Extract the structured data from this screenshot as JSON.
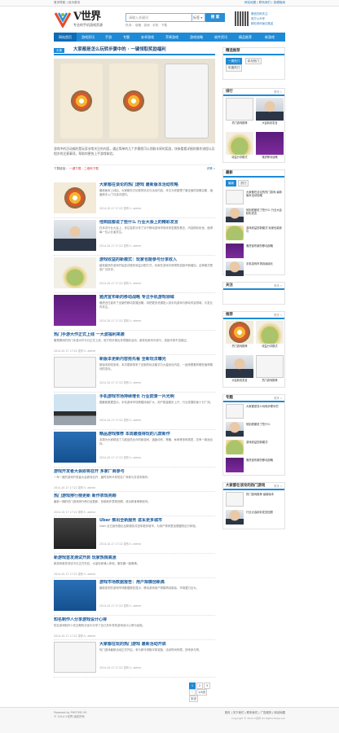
{
  "topbar": {
    "left": "首页导航 | 设为首页",
    "right": "网站地图 | 联系我们 | 投稿指南"
  },
  "logo": {
    "title": "V世界",
    "subtitle": "专业的手机游戏资源"
  },
  "search": {
    "placeholder": "请输入关键词",
    "select": "标签 ▾",
    "button": "搜 索",
    "hot": "热词： 攻略 · 游戏 · 手机 · 下载"
  },
  "header_right": {
    "line1": "微信扫码关注",
    "line2": "官方公众号",
    "line3": "精彩资讯每日推送"
  },
  "nav": [
    "网站首页",
    "游戏资讯",
    "手游",
    "专题",
    "安卓游戏",
    "苹果游戏",
    "游戏攻略",
    "软件资讯",
    "精品推荐",
    "新游戏"
  ],
  "featured": {
    "tag": "头条",
    "title": "大家都是怎么玩转步骤中的 · 一键领取奖励福利",
    "desc": "游戏中的活动福利是玩家非常关注的内容，通过简单的几个步骤就可以领取丰厚的奖励，快来看看详细的操作流程以及相关的注意事项，帮助你更快上手游戏体验。",
    "meta_label": "下载链接：",
    "meta_links": "一键下载 · 二维码下载",
    "more": "详情 »"
  },
  "posts": [
    {
      "title": "大家都在谈论的热门游戏 最新版本活动攻略",
      "desc": "最新版本上线后，大家都在讨论新的玩法与活动内容，本文为你整理了最全面的攻略合集，涵盖新手入门与高手进阶。",
      "meta": "2014-10-17 17:22 发布人: admin",
      "thumb": "t-wheel"
    },
    {
      "title": "他到底都说了些什么 行业大会上的精彩发言",
      "desc": "在本次行业大会上，多位嘉宾分享了对于移动游戏市场未来发展的看法，内容精彩纷呈，值得每一位从业者关注。",
      "meta": "2014-10-17 17:22 发布人: admin",
      "thumb": "t-person"
    },
    {
      "title": "游戏收益的新模式：玩家也能参与分享收入",
      "desc": "越来越多的游戏开始尝试新的收益分配方式，玩家在游戏中获得的奖励不断增加，这种模式受到广泛好评。",
      "meta": "2014-10-17 17:22 发布人: admin",
      "thumb": "t-money"
    },
    {
      "title": "雅虎宣布新的移动战略 专注手机游戏领域",
      "desc": "雅虎近日宣布了全新的移动发展战略，将把更多资源投入到手机游戏与移动内容领域，引发业内关注。",
      "meta": "2014-10-17 17:22 发布人: admin",
      "thumb": "t-yahoo"
    },
    {
      "title": "热门手游大作正式上线 一大波福利来袭",
      "desc": "备受期待的热门手游大作今日正式上线，官方同步推出多项福利活动，新老玩家均可参与，奖励丰厚不容错过。",
      "meta": "2014-10-17 17:22 发布人: admin",
      "text": true
    },
    {
      "title": "新版本更新内容抢先看 全新玩法曝光",
      "desc": "新版本即将到来，本次更新带来了全新的玩法模式与大量优化内容，一起来看看有哪些值得期待的变化。",
      "meta": "2014-10-17 17:22 发布人: admin",
      "thumb": "t-app"
    },
    {
      "title": "手机游戏市场持续增长 行业前景一片光明",
      "desc": "据最新数据显示，手机游戏市场规模持续扩大，用户数量稳步上升，行业发展前景十分广阔。",
      "meta": "2014-10-17 17:22 发布人: admin",
      "thumb": "t-car"
    },
    {
      "title": "精品游戏推荐 本周最值得玩的几款新作",
      "desc": "本周为大家精选了几款品质出众的新游戏，涵盖动作、策略、休闲等多种类型，总有一款适合你。",
      "meta": "2014-10-17 17:22 发布人: admin",
      "thumb": "t-blue"
    },
    {
      "title": "游戏开发者大会即将召开 多家厂商参与",
      "desc": "一年一度的游戏开发者大会即将召开，届时将有众多知名厂商参与并发布新作。",
      "meta": "2014-10-17 17:22 发布人: admin",
      "text": true
    },
    {
      "title": "热门游戏排行榜更新 新作表现亮眼",
      "desc": "最新一期的热门游戏排行榜已经更新，多款新作表现亮眼，成功跻身榜单前列。",
      "meta": "2014-10-17 17:22 发布人: admin",
      "text": true
    },
    {
      "title": "Uber 推出全新服务 进军更多城市",
      "desc": "Uber 近日宣布推出全新服务并进军更多城市，为用户带来更加便捷的出行体验。",
      "meta": "2014-10-17 17:22 发布人: admin",
      "thumb": "t-uber"
    },
    {
      "title": "新游戏首发测试开启 玩家热情高涨",
      "desc": "新游戏首发测试今日正式开启，大量玩家涌入体验，服务器一度爆满。",
      "meta": "2014-10-17 17:22 发布人: admin",
      "text": true
    },
    {
      "title": "游戏市场数据报告：用户规模创新高",
      "desc": "最新发布的游戏市场数据报告显示，移动游戏用户规模再创新高，市场潜力巨大。",
      "meta": "2014-10-17 17:22 发布人: admin",
      "thumb": "t-blue"
    },
    {
      "title": "知名制作人分享游戏设计心得",
      "desc": "知名游戏制作人在近期的访谈中分享了自己多年来的游戏设计心得与经验。",
      "meta": "2014-10-17 17:22 发布人: admin",
      "text": true
    },
    {
      "title": "大家都在玩的热门游戏 最新活动开启",
      "desc": "热门游戏最新活动正式开启，参与即可领取丰厚奖励，活动时间有限，快来参与吧。",
      "meta": "2014-10-17 17:22 发布人: admin",
      "thumb": "t-app"
    }
  ],
  "pager": [
    "1",
    "2",
    "3",
    "›",
    "1/8页",
    "末页"
  ],
  "side": {
    "b1": {
      "title": "精选推荐",
      "tabs": [
        "一周热门",
        "本月热门",
        "年度热门"
      ]
    },
    "b2": {
      "title": "排行",
      "more": "更多 »",
      "items": [
        {
          "cap": "热门游戏推荐",
          "thumb": "t-app"
        },
        {
          "cap": "大会精彩发言",
          "thumb": "t-person"
        }
      ],
      "items2": [
        {
          "cap": "收益分享模式",
          "thumb": "t-money"
        },
        {
          "cap": "雅虎移动战略",
          "thumb": "t-yahoo"
        }
      ]
    },
    "b3": {
      "title": "最新",
      "tabs": [
        "最新",
        "热门"
      ],
      "list": [
        {
          "tx": "大家都在谈论的热门游戏 最新版本活动攻略",
          "thumb": "t-app"
        },
        {
          "tx": "他到底都说了些什么 行业大会精彩发言",
          "thumb": "t-person"
        },
        {
          "tx": "游戏收益的新模式 玩家也能参与",
          "thumb": "t-money"
        },
        {
          "tx": "雅虎宣布新的移动战略",
          "thumb": "t-yahoo"
        },
        {
          "tx": "手机游戏市场持续增长",
          "thumb": "t-person"
        }
      ]
    },
    "b4": {
      "title": "关注",
      "more": "更多 »"
    },
    "b5": {
      "title": "推荐",
      "more": "更多 »",
      "items": [
        {
          "cap": "热门游戏推荐",
          "thumb": "t-wheel"
        },
        {
          "cap": "收益分享模式",
          "thumb": "t-money"
        }
      ],
      "items2": [
        {
          "cap": "大会精彩发言",
          "thumb": "t-person"
        },
        {
          "cap": "热门游戏推荐",
          "thumb": "t-app"
        }
      ]
    },
    "b6": {
      "title": "专题",
      "more": "更多 »",
      "list": [
        {
          "tx": "大家都是怎么玩转步骤中的",
          "thumb": "t-app"
        },
        {
          "tx": "他到底都说了些什么",
          "thumb": "t-person"
        },
        {
          "tx": "游戏收益的新模式",
          "thumb": "t-money"
        },
        {
          "tx": "雅虎宣布新的移动战略",
          "thumb": "t-yahoo"
        }
      ]
    },
    "b7": {
      "title": "大家都在谈论的热门游戏",
      "more": "更多 »",
      "list": [
        {
          "tx": "热门游戏推荐 最新版本",
          "thumb": "t-app"
        },
        {
          "tx": "行业大会精彩发言回顾",
          "thumb": "t-person"
        }
      ]
    }
  },
  "footer": {
    "line1": "Powered by PHPCMS V9",
    "line2": "© 2014 V世界 版权所有",
    "right": "首页 | 关于我们 | 联系我们 | 广告服务 | 网站地图",
    "right2": "Copyright © 2014 V世界 All Rights Reserved"
  }
}
